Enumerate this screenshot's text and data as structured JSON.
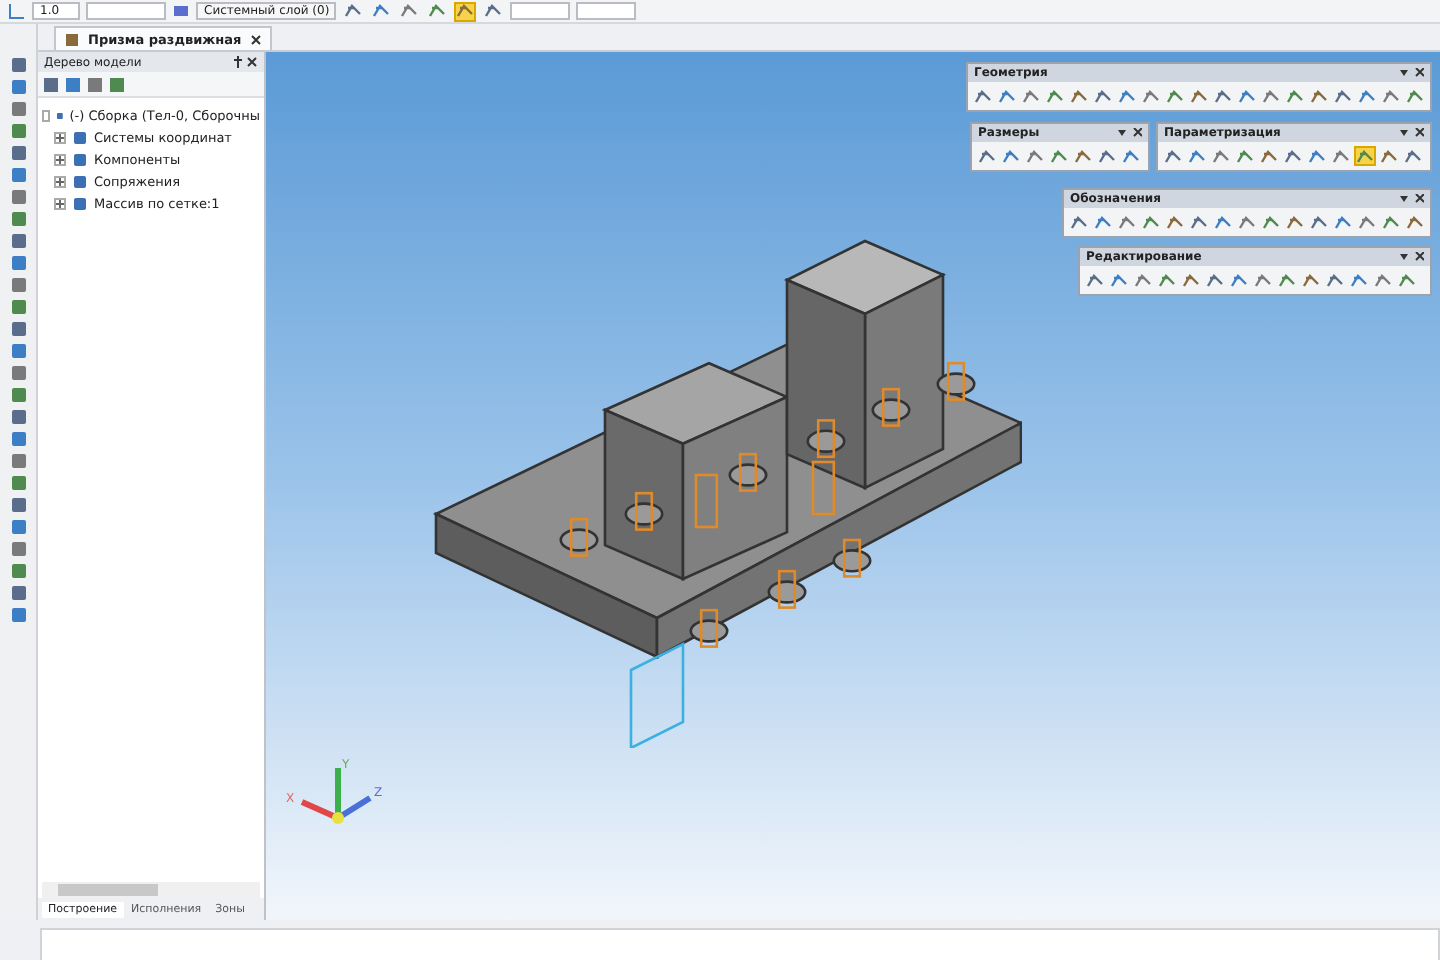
{
  "top_toolbar": {
    "scale": "1.0",
    "layer": "Системный слой (0)",
    "tools": [
      {
        "selected": false
      },
      {
        "selected": false
      },
      {
        "selected": false
      },
      {
        "selected": false
      },
      {
        "selected": true
      },
      {
        "selected": false
      }
    ]
  },
  "document_tabs": [
    {
      "label": "Призма раздвижная",
      "selected": true
    }
  ],
  "model_tree": {
    "title": "Дерево модели",
    "root": {
      "label": "(-) Сборка (Тел-0, Сборочны",
      "expanded": true,
      "children": [
        {
          "label": "Системы координат",
          "expanded": false
        },
        {
          "label": "Компоненты",
          "expanded": false
        },
        {
          "label": "Сопряжения",
          "expanded": false
        },
        {
          "label": "Массив по сетке:1",
          "expanded": false
        }
      ]
    }
  },
  "panel_tabs": [
    {
      "label": "Построение",
      "selected": true
    },
    {
      "label": "Исполнения",
      "selected": false
    },
    {
      "label": "Зоны",
      "selected": false
    }
  ],
  "toolbars": [
    {
      "title": "Геометрия",
      "tools": [
        {
          "selected": false
        },
        {
          "selected": false
        },
        {
          "selected": false
        },
        {
          "selected": false
        },
        {
          "selected": false
        },
        {
          "selected": false
        },
        {
          "selected": false
        },
        {
          "selected": false
        },
        {
          "selected": false
        },
        {
          "selected": false
        },
        {
          "selected": false
        },
        {
          "selected": false
        },
        {
          "selected": false
        },
        {
          "selected": false
        },
        {
          "selected": false
        },
        {
          "selected": false
        },
        {
          "selected": false
        },
        {
          "selected": false
        },
        {
          "selected": false
        }
      ]
    },
    {
      "title": "Размеры",
      "tools": [
        {
          "selected": false
        },
        {
          "selected": false
        },
        {
          "selected": false
        },
        {
          "selected": false
        },
        {
          "selected": false
        },
        {
          "selected": false
        },
        {
          "selected": false
        }
      ]
    },
    {
      "title": "Параметризация",
      "tools": [
        {
          "selected": false
        },
        {
          "selected": false
        },
        {
          "selected": false
        },
        {
          "selected": false
        },
        {
          "selected": false
        },
        {
          "selected": false
        },
        {
          "selected": false
        },
        {
          "selected": false
        },
        {
          "selected": true
        },
        {
          "selected": false
        },
        {
          "selected": false
        }
      ]
    },
    {
      "title": "Обозначения",
      "tools": [
        {
          "selected": false
        },
        {
          "selected": false
        },
        {
          "selected": false
        },
        {
          "selected": false
        },
        {
          "selected": false
        },
        {
          "selected": false
        },
        {
          "selected": false
        },
        {
          "selected": false
        },
        {
          "selected": false
        },
        {
          "selected": false
        },
        {
          "selected": false
        },
        {
          "selected": false
        },
        {
          "selected": false
        },
        {
          "selected": false
        },
        {
          "selected": false
        }
      ]
    },
    {
      "title": "Редактирование",
      "tools": [
        {
          "selected": false
        },
        {
          "selected": false
        },
        {
          "selected": false
        },
        {
          "selected": false
        },
        {
          "selected": false
        },
        {
          "selected": false
        },
        {
          "selected": false
        },
        {
          "selected": false
        },
        {
          "selected": false
        },
        {
          "selected": false
        },
        {
          "selected": false
        },
        {
          "selected": false
        },
        {
          "selected": false
        },
        {
          "selected": false
        }
      ]
    }
  ],
  "axes": {
    "x": "X",
    "y": "Y",
    "z": "Z"
  }
}
